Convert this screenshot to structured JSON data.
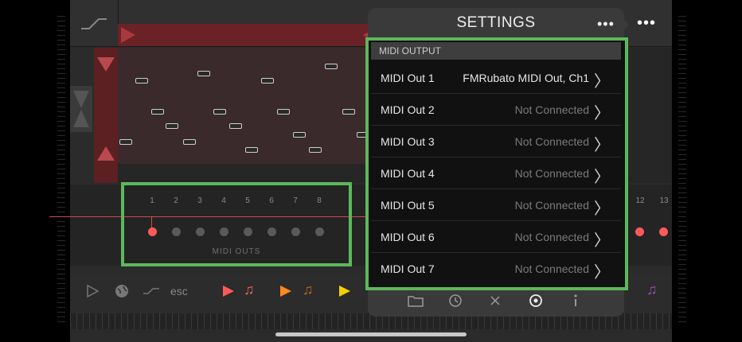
{
  "settings": {
    "title": "SETTINGS",
    "menu_icon": "more-dots-icon",
    "section_header": "MIDI OUTPUT",
    "outputs": [
      {
        "name": "MIDI Out 1",
        "value": "FMRubato MIDI Out, Ch1",
        "connected": true
      },
      {
        "name": "MIDI Out 2",
        "value": "Not Connected",
        "connected": false
      },
      {
        "name": "MIDI Out 3",
        "value": "Not Connected",
        "connected": false
      },
      {
        "name": "MIDI Out 4",
        "value": "Not Connected",
        "connected": false
      },
      {
        "name": "MIDI Out 5",
        "value": "Not Connected",
        "connected": false
      },
      {
        "name": "MIDI Out 6",
        "value": "Not Connected",
        "connected": false
      },
      {
        "name": "MIDI Out 7",
        "value": "Not Connected",
        "connected": false
      }
    ],
    "toolbar": [
      "folder-icon",
      "history-icon",
      "close-icon",
      "settings-gear-icon",
      "info-icon"
    ],
    "toolbar_active": "settings-gear-icon"
  },
  "channels": {
    "numbers": [
      "1",
      "2",
      "3",
      "4",
      "5",
      "6",
      "7",
      "8"
    ],
    "active_channel": "1",
    "label": "MIDI OUTS",
    "extra_numbers": [
      "12",
      "13"
    ]
  },
  "bottom_toolbar": {
    "esc_label": "esc",
    "icons": [
      "play-outline-icon",
      "globe-icon",
      "curve-icon",
      "play-red-icon",
      "music-note-icon",
      "play-orange-icon",
      "music-note-orange-icon",
      "play-yellow-icon",
      "music-note-purple-icon"
    ]
  },
  "colors": {
    "accent_green": "#5cb85c",
    "active_red": "#ff5a5a",
    "pattern_red": "#6b2226"
  }
}
